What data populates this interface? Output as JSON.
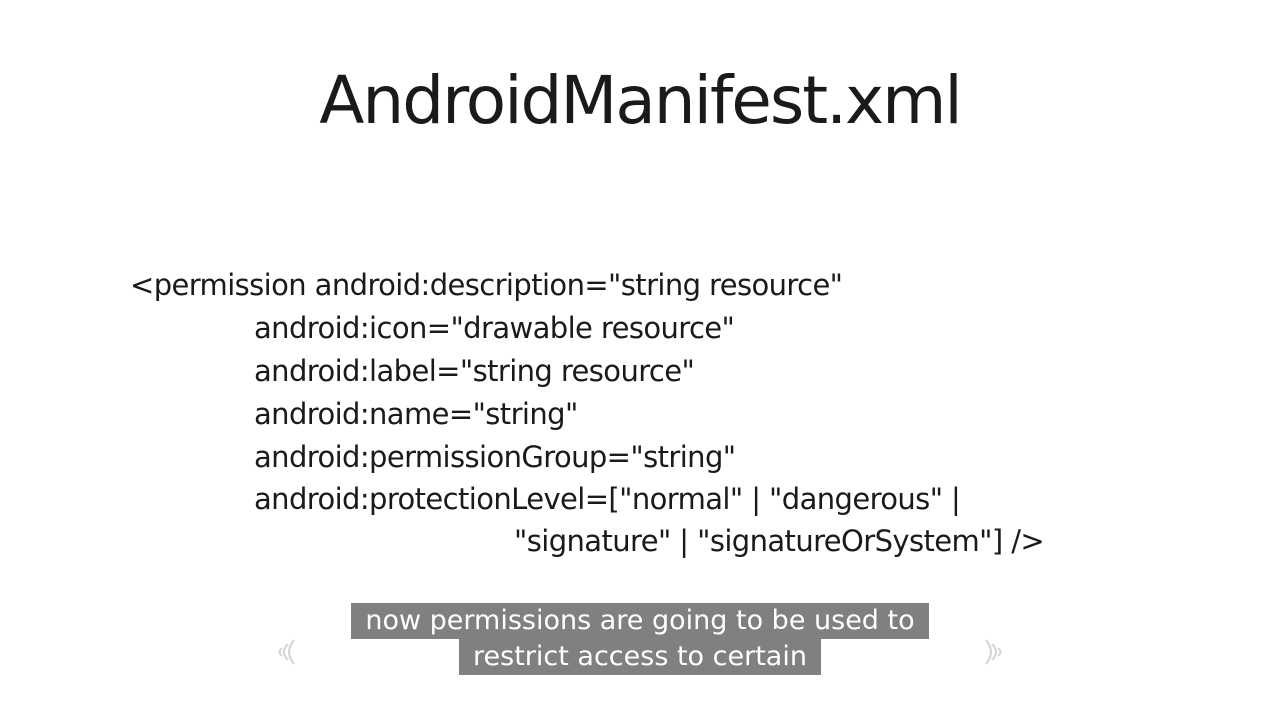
{
  "slide": {
    "title": "AndroidManifest.xml",
    "code_lines": [
      "<permission android:description=\"string resource\"",
      "android:icon=\"drawable resource\"",
      "android:label=\"string resource\"",
      "android:name=\"string\"",
      "android:permissionGroup=\"string\"",
      "android:protectionLevel=[\"normal\" | \"dangerous\" |",
      "\"signature\" | \"signatureOrSystem\"] />"
    ]
  },
  "caption": {
    "line1": "now permissions are going to be used to",
    "line2": "restrict access to certain"
  },
  "icons": {
    "left": "sound-wave-icon",
    "right": "sound-wave-icon"
  }
}
